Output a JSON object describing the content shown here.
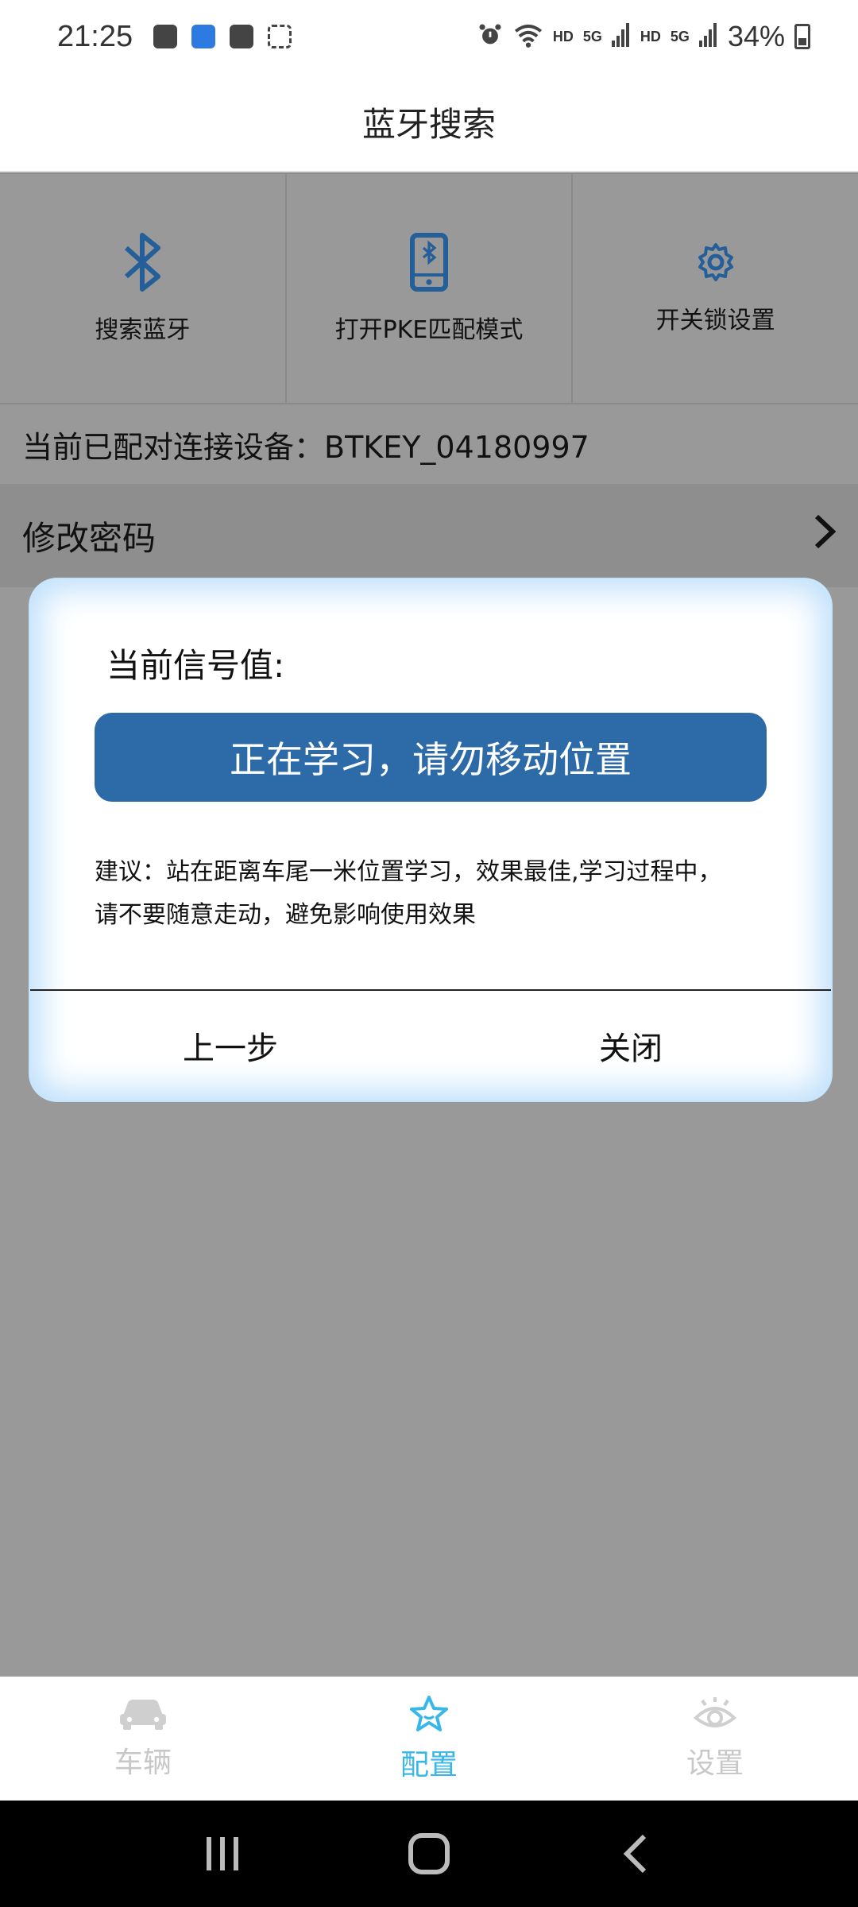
{
  "status_bar": {
    "time": "21:25",
    "network_1": "HD",
    "gen_1": "5G",
    "network_2": "HD",
    "gen_2": "5G",
    "battery": "34%"
  },
  "header": {
    "title": "蓝牙搜索"
  },
  "grid": [
    {
      "label": "搜索蓝牙",
      "icon": "bluetooth-icon"
    },
    {
      "label": "打开PKE匹配模式",
      "icon": "phone-bluetooth-icon"
    },
    {
      "label": "开关锁设置",
      "icon": "gear-icon"
    }
  ],
  "paired_device": "当前已配对连接设备：BTKEY_04180997",
  "change_password": {
    "label": "修改密码"
  },
  "dialog": {
    "signal_label": "当前信号值:",
    "learning_button": "正在学习，请勿移动位置",
    "tip_line1": "建议：站在距离车尾一米位置学习，效果最佳,学习过程中，",
    "tip_line2": "请不要随意走动，避免影响使用效果",
    "prev_label": "上一步",
    "close_label": "关闭"
  },
  "bottom_nav": [
    {
      "label": "车辆",
      "icon": "car-icon",
      "active": false
    },
    {
      "label": "配置",
      "icon": "star-icon",
      "active": true
    },
    {
      "label": "设置",
      "icon": "eye-icon",
      "active": false
    }
  ],
  "colors": {
    "primary_blue": "#2c6ba8",
    "accent_cyan": "#37b8e8",
    "overlay_gray": "#999999"
  }
}
